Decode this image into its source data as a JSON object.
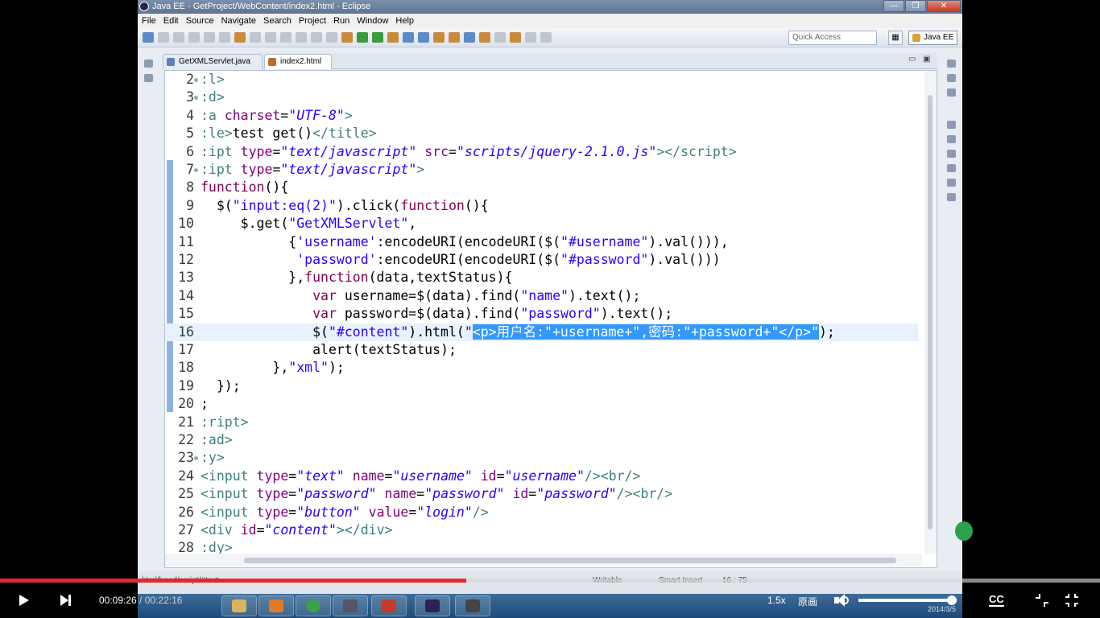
{
  "window": {
    "title": "Java EE - GetProject/WebContent/index2.html - Eclipse",
    "buttons": {
      "minimize": "—",
      "maximize": "❐",
      "close": "✕"
    }
  },
  "menu": [
    "File",
    "Edit",
    "Source",
    "Navigate",
    "Search",
    "Project",
    "Run",
    "Window",
    "Help"
  ],
  "toolbar": {
    "quick_access_placeholder": "Quick Access",
    "perspective_label": "Java EE"
  },
  "tabs": [
    {
      "label": "GetXMLServlet.java",
      "active": false,
      "icon": "java-file-icon"
    },
    {
      "label": "index2.html",
      "active": true,
      "icon": "html-file-icon",
      "close": "☒"
    }
  ],
  "editor": {
    "lines": [
      {
        "n": "2",
        "fold": true,
        "html": "<span class='t-tag'>:l&gt;</span>"
      },
      {
        "n": "3",
        "fold": true,
        "html": "<span class='t-tag'>:d&gt;</span>"
      },
      {
        "n": "4",
        "fold": false,
        "html": "<span class='t-tag'>:a</span> <span class='t-attr'>charset</span>=<span class='t-val'>\"UTF-8\"</span><span class='t-tag'>&gt;</span>"
      },
      {
        "n": "5",
        "fold": false,
        "html": "<span class='t-tag'>:le&gt;</span>test get()<span class='t-tag'>&lt;/title&gt;</span>"
      },
      {
        "n": "6",
        "fold": false,
        "html": "<span class='t-tag'>:ipt</span> <span class='t-attr'>type</span>=<span class='t-val'>\"text/javascript\"</span> <span class='t-attr'>src</span>=<span class='t-val'>\"scripts/jquery-2.1.0.js\"</span><span class='t-tag'>&gt;&lt;/script&gt;</span>"
      },
      {
        "n": "7",
        "fold": true,
        "html": "<span class='t-tag'>:ipt</span> <span class='t-attr'>type</span>=<span class='t-val'>\"text/javascript\"</span><span class='t-tag'>&gt;</span>"
      },
      {
        "n": "8",
        "fold": false,
        "html": "<span class='t-kw'>function</span>(){"
      },
      {
        "n": "9",
        "fold": false,
        "html": "  $(<span class='t-str'>\"input:eq(2)\"</span>).click(<span class='t-kw'>function</span>(){"
      },
      {
        "n": "10",
        "fold": false,
        "html": "     $.get(<span class='t-str'>\"GetXMLServlet\"</span>,"
      },
      {
        "n": "11",
        "fold": false,
        "html": "           {<span class='t-str'>'username'</span>:encodeURI(encodeURI($(<span class='t-str'>\"#username\"</span>).val())),"
      },
      {
        "n": "12",
        "fold": false,
        "html": "            <span class='t-str'>'password'</span>:encodeURI(encodeURI($(<span class='t-str'>\"#password\"</span>).val()))"
      },
      {
        "n": "13",
        "fold": false,
        "html": "           },<span class='t-kw'>function</span>(data,textStatus){"
      },
      {
        "n": "14",
        "fold": false,
        "html": "              <span class='t-kw'>var</span> username=$(data).find(<span class='t-str'>\"name\"</span>).text();"
      },
      {
        "n": "15",
        "fold": false,
        "html": "              <span class='t-kw'>var</span> password=$(data).find(<span class='t-str'>\"password\"</span>).text();"
      },
      {
        "n": "16",
        "fold": false,
        "current": true,
        "html": "              $(<span class='t-str'>\"#content\"</span>).html(<span class='t-str'>\"</span><span class='t-sel'>&lt;p&gt;用户名:\"+username+\",密码:\"+password+\"&lt;/p&gt;\"</span>);"
      },
      {
        "n": "17",
        "fold": false,
        "html": "              alert(textStatus);"
      },
      {
        "n": "18",
        "fold": false,
        "html": "         },<span class='t-str'>\"xml\"</span>);"
      },
      {
        "n": "19",
        "fold": false,
        "html": "  });"
      },
      {
        "n": "20",
        "fold": false,
        "html": ";"
      },
      {
        "n": "21",
        "fold": false,
        "html": "<span class='t-tag'>:ript&gt;</span>"
      },
      {
        "n": "22",
        "fold": false,
        "html": "<span class='t-tag'>:ad&gt;</span>"
      },
      {
        "n": "23",
        "fold": true,
        "html": "<span class='t-tag'>:y&gt;</span>"
      },
      {
        "n": "24",
        "fold": false,
        "html": "<span class='t-tag'>&lt;input</span> <span class='t-attr'>type</span>=<span class='t-val'>\"text\"</span> <span class='t-attr'>name</span>=<span class='t-val'>\"username\"</span> <span class='t-attr'>id</span>=<span class='t-val'>\"username\"</span><span class='t-tag'>/&gt;&lt;br/&gt;</span>"
      },
      {
        "n": "25",
        "fold": false,
        "html": "<span class='t-tag'>&lt;input</span> <span class='t-attr'>type</span>=<span class='t-val'>\"password\"</span> <span class='t-attr'>name</span>=<span class='t-val'>\"password\"</span> <span class='t-attr'>id</span>=<span class='t-val'>\"password\"</span><span class='t-tag'>/&gt;&lt;br/&gt;</span>"
      },
      {
        "n": "26",
        "fold": false,
        "html": "<span class='t-tag'>&lt;input</span> <span class='t-attr'>type</span>=<span class='t-val'>\"button\"</span> <span class='t-attr'>value</span>=<span class='t-val'>\"login\"</span><span class='t-tag'>/&gt;</span>"
      },
      {
        "n": "27",
        "fold": false,
        "html": "<span class='t-tag'>&lt;div</span> <span class='t-attr'>id</span>=<span class='t-val'>\"content\"</span><span class='t-tag'>&gt;&lt;/div&gt;</span>"
      },
      {
        "n": "28",
        "fold": false,
        "html": "<span class='t-tag'>:dy&gt;</span>"
      }
    ]
  },
  "statusbar": {
    "path": "html/head/script/#text",
    "writable": "Writable",
    "insert_mode": "Smart Insert",
    "position": "16 : 75"
  },
  "player": {
    "current_time": "00:09:26",
    "separator": " / ",
    "duration": "00:22:16",
    "progress": 0.424,
    "speed": "1.5x",
    "quality": "原画",
    "volume": 0.95,
    "cc_label": "CC"
  },
  "taskbar": {
    "date": "2014/3/5"
  }
}
